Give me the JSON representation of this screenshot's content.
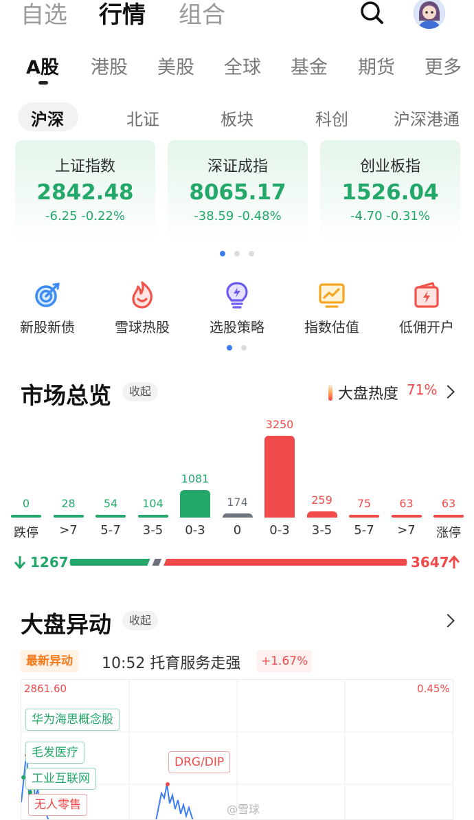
{
  "top_tabs": [
    "自选",
    "行情",
    "组合"
  ],
  "active_top_tab": "行情",
  "market_tabs": [
    "A股",
    "港股",
    "美股",
    "全球",
    "基金",
    "期货",
    "更多"
  ],
  "sub_tabs": [
    "沪深",
    "北证",
    "板块",
    "科创",
    "沪深港通"
  ],
  "indices": [
    {
      "name": "上证指数",
      "value": "2842.48",
      "change": "-6.25 -0.22%"
    },
    {
      "name": "深证成指",
      "value": "8065.17",
      "change": "-38.59 -0.48%"
    },
    {
      "name": "创业板指",
      "value": "1526.04",
      "change": "-4.70 -0.31%"
    }
  ],
  "tools": [
    {
      "label": "新股新债",
      "icon": "target-icon"
    },
    {
      "label": "雪球热股",
      "icon": "flame-icon"
    },
    {
      "label": "选股策略",
      "icon": "lightbulb-icon"
    },
    {
      "label": "指数估值",
      "icon": "trend-chart-icon"
    },
    {
      "label": "低佣开户",
      "icon": "wallet-bolt-icon"
    }
  ],
  "market_overview": {
    "title": "市场总览",
    "collapse_label": "收起",
    "heat_label": "大盘热度",
    "heat_value": "71%",
    "down_total": "1267",
    "up_total": "3647",
    "colors": {
      "down": "#23a86a",
      "flat": "#6e7380",
      "up": "#f04a4a"
    }
  },
  "chart_data": {
    "type": "bar",
    "categories": [
      "跌停",
      ">7",
      "5-7",
      "3-5",
      "0-3",
      "0",
      "0-3",
      "3-5",
      "5-7",
      ">7",
      "涨停"
    ],
    "values": [
      0,
      28,
      54,
      104,
      1081,
      174,
      3250,
      259,
      75,
      63,
      63
    ],
    "labels": [
      "0",
      "28",
      "54",
      "104",
      "1081",
      "174",
      "3250",
      "259",
      "75",
      "63",
      "63"
    ],
    "groups": [
      "down",
      "down",
      "down",
      "down",
      "down",
      "flat",
      "up",
      "up",
      "up",
      "up",
      "up"
    ]
  },
  "movement": {
    "title": "大盘异动",
    "collapse_label": "收起",
    "badge": "最新异动",
    "event": "10:52 托育服务走强",
    "event_pct": "+1.67%",
    "chart_high": "2861.60",
    "chart_pct": "0.45%",
    "tags": [
      "华为海思概念股",
      "毛发医疗",
      "DRG/DIP",
      "工业互联网",
      "无人零售"
    ],
    "watermark": "@雪球"
  }
}
